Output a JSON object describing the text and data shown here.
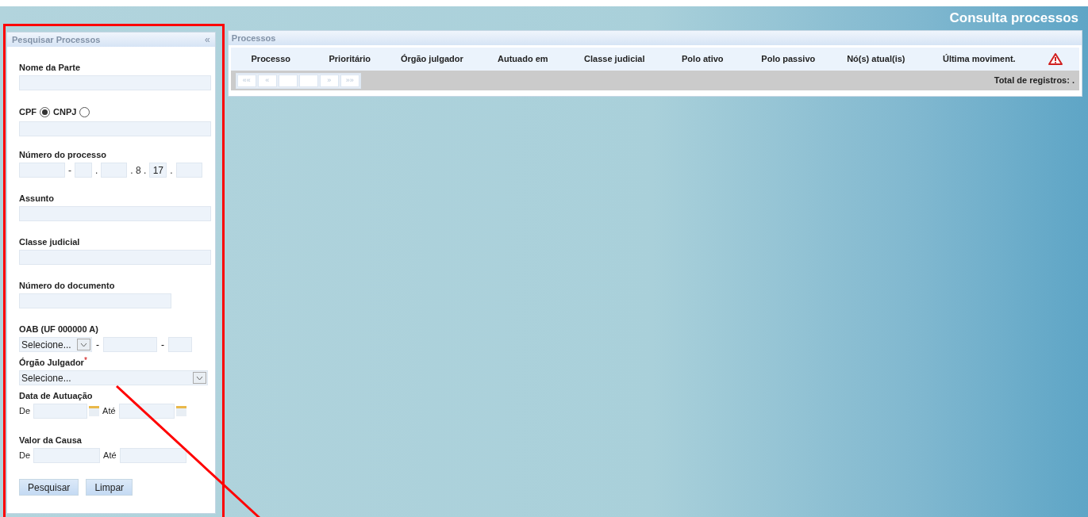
{
  "page_title": "Consulta processos",
  "search_panel": {
    "title": "Pesquisar Processos",
    "collapse": "«",
    "fields": [
      {
        "kind": "text",
        "label": "Nome da Parte"
      },
      {
        "kind": "radio",
        "options": [
          {
            "label": "CPF",
            "selected": true
          },
          {
            "label": "CNPJ",
            "selected": false
          }
        ]
      },
      {
        "kind": "process",
        "label": "Número do processo",
        "parts": [
          {
            "kind": "field"
          },
          {
            "kind": "sep",
            "text": "-"
          },
          {
            "kind": "field"
          },
          {
            "kind": "sep",
            "text": "."
          },
          {
            "kind": "field"
          },
          {
            "kind": "sep",
            "text": ". 8 ."
          },
          {
            "kind": "field",
            "value": "17"
          },
          {
            "kind": "sep",
            "text": "."
          },
          {
            "kind": "field"
          }
        ]
      },
      {
        "kind": "text",
        "label": "Assunto"
      },
      {
        "kind": "text",
        "label": "Classe judicial"
      },
      {
        "kind": "short",
        "label": "Número do documento"
      },
      {
        "kind": "oab",
        "label": "OAB (UF 000000 A)",
        "select": "Selecione...",
        "separators": [
          "-",
          "-"
        ]
      },
      {
        "kind": "select",
        "label": "Órgão Julgador",
        "required_mark": "*",
        "value": "Selecione..."
      },
      {
        "kind": "daterange",
        "label": "Data de Autuação",
        "from": "De",
        "to": "Até"
      },
      {
        "kind": "range",
        "label": "Valor da Causa",
        "from": "De",
        "to": "Até"
      }
    ],
    "buttons": [
      "Pesquisar",
      "Limpar"
    ]
  },
  "results_panel": {
    "title": "Processos",
    "columns": [
      "Processo",
      "Prioritário",
      "Órgão julgador",
      "Autuado em",
      "Classe judicial",
      "Polo ativo",
      "Polo passivo",
      "Nó(s) atual(is)",
      "Última moviment."
    ],
    "pager": [
      {
        "kind": "button",
        "label": "««"
      },
      {
        "kind": "button",
        "label": "«"
      },
      {
        "kind": "blank"
      },
      {
        "kind": "blank"
      },
      {
        "kind": "button",
        "label": "»"
      },
      {
        "kind": "button",
        "label": "»»"
      }
    ],
    "total": "Total de registros: ."
  }
}
